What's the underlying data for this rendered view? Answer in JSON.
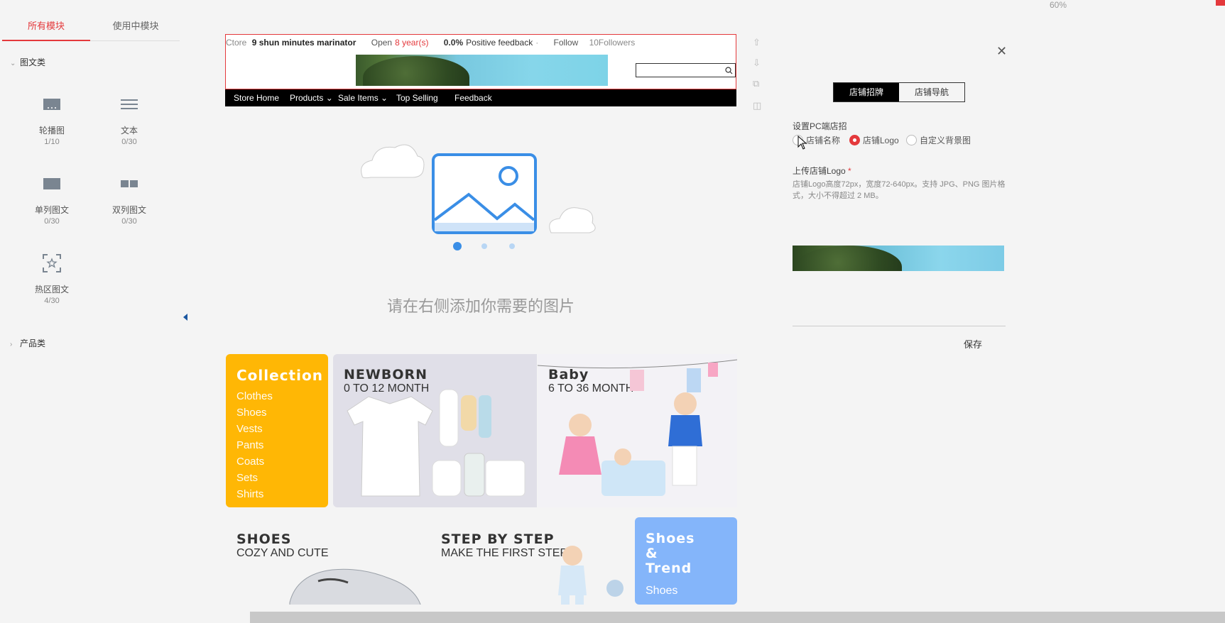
{
  "left_panel": {
    "tabs": [
      {
        "label": "所有模块"
      },
      {
        "label": "使用中模块"
      }
    ],
    "categories": [
      {
        "label": "图文类"
      },
      {
        "label": "产品类"
      }
    ],
    "modules": [
      {
        "name": "轮播图",
        "count": "1/10",
        "icon": "carousel-icon"
      },
      {
        "name": "文本",
        "count": "0/30",
        "icon": "text-lines-icon"
      },
      {
        "name": "单列图文",
        "count": "0/30",
        "icon": "single-column-icon"
      },
      {
        "name": "双列图文",
        "count": "0/30",
        "icon": "double-column-icon"
      },
      {
        "name": "热区图文",
        "count": "4/30",
        "icon": "hotspot-icon"
      }
    ]
  },
  "store_header": {
    "store_label": "Ctore",
    "store_name": "9 shun minutes marinator",
    "open_label": "Open",
    "open_years": "8 year(s)",
    "feedback_value": "0.0%",
    "feedback_label": "Positive feedback",
    "separator": "·",
    "follow_label": "Follow",
    "followers": "10Followers",
    "nav": [
      {
        "label": "Store Home"
      },
      {
        "label": "Products"
      },
      {
        "label": "Sale Items"
      },
      {
        "label": "Top Selling"
      },
      {
        "label": "Feedback"
      }
    ]
  },
  "canvas": {
    "placeholder_text": "请在右侧添加你需要的图片",
    "carousel_dots": 3
  },
  "tiles": {
    "collection": {
      "title": "Collection",
      "items": [
        "Clothes",
        "Shoes",
        "Vests",
        "Pants",
        "Coats",
        "Sets",
        "Shirts"
      ]
    },
    "newborn": {
      "title": "NEWBORN",
      "subtitle": "0 TO 12 MONTH"
    },
    "baby": {
      "title": "Baby",
      "subtitle": "6 TO 36 MONTH"
    },
    "shoes": {
      "title": "SHOES",
      "subtitle": "COZY AND CUTE"
    },
    "step": {
      "title": "STEP BY STEP",
      "subtitle": "MAKE THE FIRST STEP"
    },
    "trend": {
      "title_1": "Shoes",
      "title_2": "&",
      "title_3": "Trend",
      "item": "Shoes"
    }
  },
  "right_panel": {
    "segments": [
      {
        "label": "店铺招牌"
      },
      {
        "label": "店铺导航"
      }
    ],
    "section_label": "设置PC端店招",
    "radios": [
      {
        "label": "店铺名称",
        "selected": false
      },
      {
        "label": "店铺Logo",
        "selected": true
      },
      {
        "label": "自定义背景图",
        "selected": false
      }
    ],
    "upload_label": "上传店铺Logo",
    "required_mark": "*",
    "hint": "店铺Logo高度72px，宽度72-640px。支持 JPG、PNG 图片格式，大小不得超过 2 MB。",
    "save_label": "保存"
  },
  "zoom": "60%",
  "colors": {
    "accent": "#e4393c",
    "collection_bg": "#ffb705",
    "trend_bg": "#84b5fa",
    "carousel_blue": "#3a8ee6"
  }
}
